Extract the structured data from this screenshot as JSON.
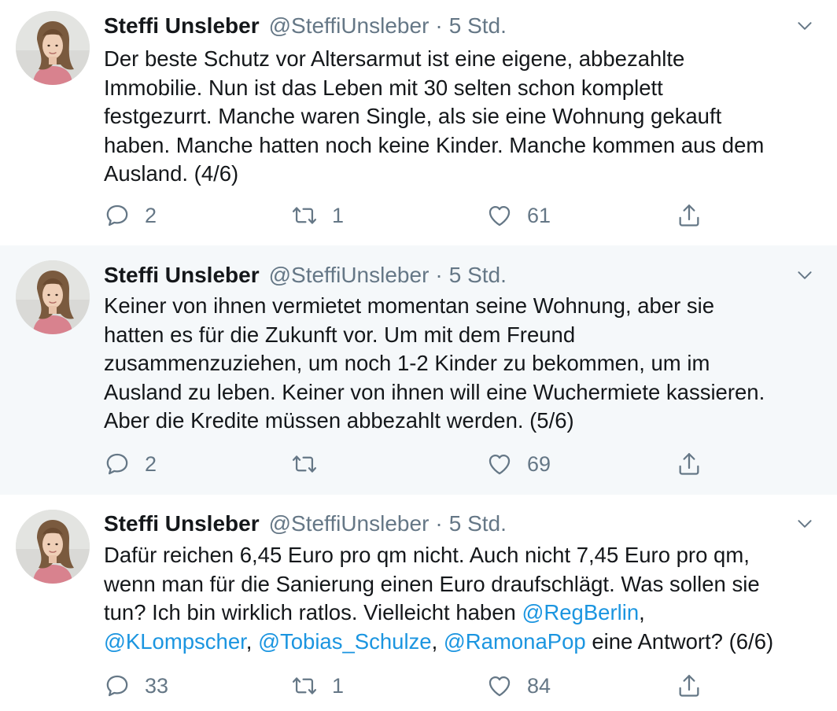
{
  "tweets": [
    {
      "author_name": "Steffi Unsleber",
      "handle": "@SteffiUnsleber",
      "separator": "·",
      "time": "5 Std.",
      "lines": [
        "Der beste Schutz vor Altersarmut ist eine eigene, abbezahlte",
        "Immobilie. Nun ist das Leben mit 30 selten schon komplett",
        "festgezurrt. Manche waren Single, als sie eine Wohnung gekauft",
        "haben. Manche hatten noch keine Kinder. Manche kommen aus dem",
        "Ausland. (4/6)"
      ],
      "replies": "2",
      "retweets": "1",
      "likes": "61"
    },
    {
      "author_name": "Steffi Unsleber",
      "handle": "@SteffiUnsleber",
      "separator": "·",
      "time": "5 Std.",
      "lines": [
        "Keiner von ihnen vermietet momentan seine Wohnung, aber sie",
        "hatten es für die Zukunft vor. Um mit dem Freund",
        "zusammenzuziehen, um noch 1-2 Kinder zu bekommen, um im",
        "Ausland zu leben. Keiner von ihnen will eine Wuchermiete kassieren.",
        "Aber die Kredite müssen abbezahlt werden. (5/6)"
      ],
      "replies": "2",
      "retweets": "",
      "likes": "69"
    },
    {
      "author_name": "Steffi Unsleber",
      "handle": "@SteffiUnsleber",
      "separator": "·",
      "time": "5 Std.",
      "lines": [
        "Dafür reichen 6,45 Euro pro qm nicht. Auch nicht 7,45 Euro pro qm,",
        "wenn man für die Sanierung einen Euro draufschlägt. Was sollen sie",
        "tun? Ich bin wirklich ratlos. Vielleicht haben "
      ],
      "mention_1": "@RegBerlin",
      "mention_2": "@KLompscher",
      "mention_3": "@Tobias_Schulze",
      "mention_4": "@RamonaPop",
      "comma": ",",
      "closing": " eine Antwort? (6/6)",
      "replies": "33",
      "retweets": "1",
      "likes": "84"
    }
  ],
  "colors": {
    "text": "#14171a",
    "muted": "#657786",
    "link": "#1b95e0",
    "thread_line": "#ccd6dd",
    "highlight_bg": "#f5f8fa"
  },
  "icons": {
    "reply": "reply-icon",
    "retweet": "retweet-icon",
    "like": "heart-icon",
    "share": "share-icon",
    "menu": "chevron-down-icon"
  }
}
